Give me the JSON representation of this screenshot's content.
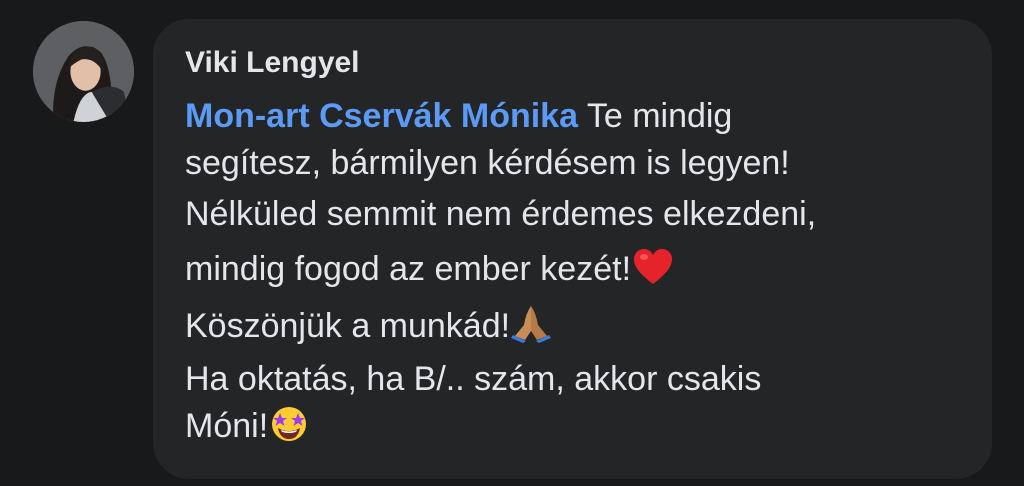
{
  "comment": {
    "author": "Viki Lengyel",
    "mention": "Mon-art Cservák Mónika",
    "lines": [
      " Te mindig",
      "segítesz, bármilyen kérdésem is legyen!",
      "Nélküled semmit nem érdemes elkezdeni,",
      "mindig fogod az ember kezét!",
      "Köszönjük a munkád!",
      "Ha oktatás, ha B/.. szám, akkor csakis",
      "Móni!"
    ],
    "emojis": [
      "red-heart",
      "folded-hands",
      "star-struck"
    ]
  },
  "colors": {
    "background": "#18191a",
    "bubble": "#242526",
    "text": "#e4e6eb",
    "mention": "#5b9af5"
  }
}
